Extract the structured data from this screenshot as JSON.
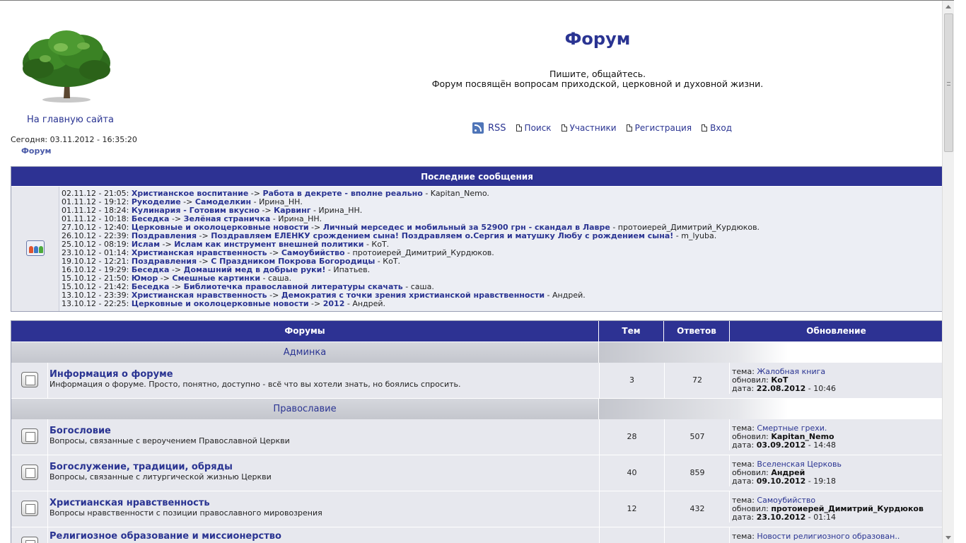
{
  "header": {
    "title": "Форум",
    "tagline_1": "Пишите, общайтесь.",
    "tagline_2": "Форум посвящён вопросам приходской, церковной и духовной жизни.",
    "home_link": "На главную сайта",
    "today": "Сегодня: 03.11.2012 - 16:35:20",
    "breadcrumb": "Форум"
  },
  "topnav": {
    "rss": "RSS",
    "search": "Поиск",
    "members": "Участники",
    "register": "Регистрация",
    "login": "Вход"
  },
  "recent": {
    "title": "Последние сообщения",
    "items": [
      {
        "date": "02.11.12 - 21:05:",
        "forum": "Христианское воспитание",
        "topic": "Работа в декрете - вполне реально",
        "author": "Kapitan_Nemo."
      },
      {
        "date": "01.11.12 - 19:12:",
        "forum": "Рукоделие",
        "topic": "Самоделкин",
        "author": "Ирина_НН."
      },
      {
        "date": "01.11.12 - 18:24:",
        "forum": "Кулинария - Готовим вкусно",
        "topic": "Карвинг",
        "author": "Ирина_НН."
      },
      {
        "date": "01.11.12 - 10:18:",
        "forum": "Беседка",
        "topic": "Зелёная страничка",
        "author": "Ирина_НН."
      },
      {
        "date": "27.10.12 - 12:40:",
        "forum": "Церковные и околоцерковные новости",
        "topic": "Личный мерседес и мобильный за 52900 грн - скандал в Лавре",
        "author": "протоиерей_Димитрий_Курдюков."
      },
      {
        "date": "26.10.12 - 22:39:",
        "forum": "Поздравления",
        "topic": "Поздравляем ЕЛЕНКУ срождением сына! Поздравляем о.Сергия и матушку Любу с рождением сына!",
        "author": "m_lyuba."
      },
      {
        "date": "25.10.12 - 08:19:",
        "forum": "Ислам",
        "topic": "Ислам как инструмент внешней политики",
        "author": "КоТ."
      },
      {
        "date": "23.10.12 - 01:14:",
        "forum": "Христианская нравственность",
        "topic": "Самоубийство",
        "author": "протоиерей_Димитрий_Курдюков."
      },
      {
        "date": "19.10.12 - 12:21:",
        "forum": "Поздравления",
        "topic": "С Праздником Покрова Богородицы",
        "author": "КоТ."
      },
      {
        "date": "16.10.12 - 19:29:",
        "forum": "Беседка",
        "topic": "Домашний мед в добрые руки!",
        "author": "Ипатьев."
      },
      {
        "date": "15.10.12 - 21:50:",
        "forum": "Юмор",
        "topic": "Смешные картинки",
        "author": "саша."
      },
      {
        "date": "15.10.12 - 21:42:",
        "forum": "Беседка",
        "topic": "Библиотечка православной литературы скачать",
        "author": "саша."
      },
      {
        "date": "13.10.12 - 23:39:",
        "forum": "Христианская нравственность",
        "topic": "Демократия с точки зрения христианской нравственности",
        "author": "Андрей."
      },
      {
        "date": "13.10.12 - 22:25:",
        "forum": "Церковные и околоцерковные новости",
        "topic": "2012",
        "author": "Андрей."
      }
    ]
  },
  "forums": {
    "headers": {
      "forums": "Форумы",
      "topics": "Тем",
      "replies": "Ответов",
      "update": "Обновление"
    },
    "labels": {
      "topic": "тема:",
      "updated_by": "обновил:",
      "date": "дата:"
    },
    "categories": [
      {
        "name": "Админка",
        "rows": [
          {
            "title": "Информация о форуме",
            "desc": "Информация о форуме. Просто, понятно, доступно - всё что вы хотели знать, но боялись спросить.",
            "topics": "3",
            "replies": "72",
            "last_topic": "Жалобная книга",
            "last_user": "КоТ",
            "last_date": "22.08.2012",
            "last_time": " - 10:46"
          }
        ]
      },
      {
        "name": "Православие",
        "rows": [
          {
            "title": "Богословие",
            "desc": "Вопросы, связанные с вероучением Православной Церкви",
            "topics": "28",
            "replies": "507",
            "last_topic": "Смертные грехи.",
            "last_user": "Kapitan_Nemo",
            "last_date": "03.09.2012",
            "last_time": " - 14:48"
          },
          {
            "title": "Богослужение, традиции, обряды",
            "desc": "Вопросы, связанные с литургической жизнью Церкви",
            "topics": "40",
            "replies": "859",
            "last_topic": "Вселенская Церковь",
            "last_user": "Андрей",
            "last_date": "09.10.2012",
            "last_time": " - 19:18"
          },
          {
            "title": "Христианская нравственность",
            "desc": "Вопросы нравственности с позиции православного мировозрения",
            "topics": "12",
            "replies": "432",
            "last_topic": "Самоубийство",
            "last_user": "протоиерей_Димитрий_Курдюков",
            "last_date": "23.10.2012",
            "last_time": " - 01:14"
          },
          {
            "title": "Религиозное образование и миссионерство",
            "desc": "",
            "topics": "",
            "replies": "",
            "last_topic": "Новости религиозного образован..",
            "last_user": "",
            "last_date": "",
            "last_time": ""
          }
        ]
      }
    ]
  }
}
